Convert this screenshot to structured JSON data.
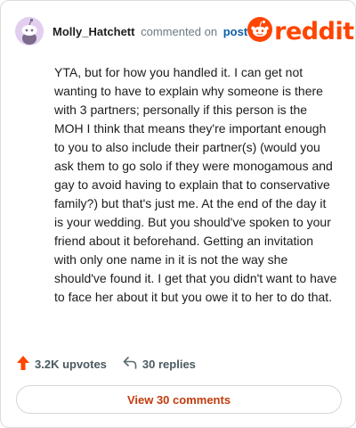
{
  "comment": {
    "username": "Molly_Hatchett",
    "verb": "commented on",
    "post_link": "post",
    "text": "YTA, but for how you handled it. I can get not wanting to have to explain why someone is there with 3 partners; personally if this person is the MOH I think that means they're important enough to you to also include their partner(s) (would you ask them to go solo if they were monogamous and gay to avoid having to explain that to conservative family?) but that's just me. At the end of the day it is your wedding. But you should've spoken to your friend about it beforehand. Getting an invitation with only one name in it is not the way she should've found it. I get that you didn't want to have to face her about it but you owe it to her to do that."
  },
  "brand": {
    "wordmark": "reddit",
    "color": "#ff4500"
  },
  "actions": {
    "upvotes": "3.2K upvotes",
    "replies": "30 replies"
  },
  "footer": {
    "view_comments": "View 30 comments"
  },
  "icons": {
    "avatar": "snoo-avatar-icon",
    "logo": "reddit-alien-icon",
    "upvote": "upvote-arrow-icon",
    "reply": "reply-arrow-icon"
  }
}
